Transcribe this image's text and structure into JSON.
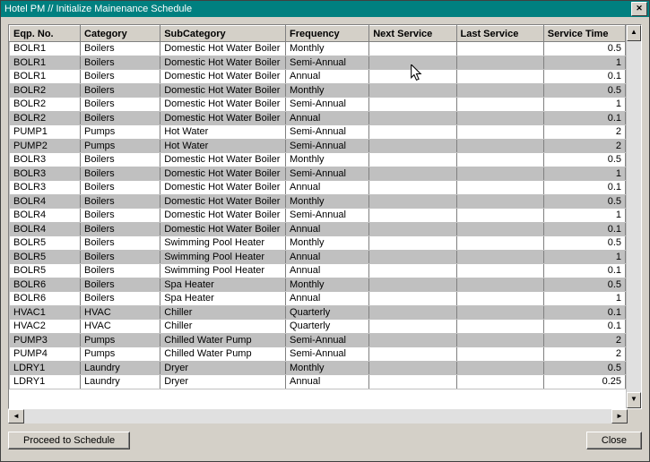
{
  "window": {
    "title": "Hotel PM // Initialize Mainenance Schedule"
  },
  "columns": [
    {
      "key": "eqp",
      "label": "Eqp. No.",
      "cls": "col-eqp"
    },
    {
      "key": "cat",
      "label": "Category",
      "cls": "col-cat"
    },
    {
      "key": "sub",
      "label": "SubCategory",
      "cls": "col-sub"
    },
    {
      "key": "freq",
      "label": "Frequency",
      "cls": "col-freq"
    },
    {
      "key": "next",
      "label": "Next Service",
      "cls": "col-next"
    },
    {
      "key": "last",
      "label": "Last Service",
      "cls": "col-last"
    },
    {
      "key": "time",
      "label": "Service Time",
      "cls": "col-time",
      "numeric": true
    }
  ],
  "rows": [
    {
      "eqp": "BOLR1",
      "cat": "Boilers",
      "sub": "Domestic Hot Water Boiler",
      "freq": "Monthly",
      "next": "",
      "last": "",
      "time": "0.5"
    },
    {
      "eqp": "BOLR1",
      "cat": "Boilers",
      "sub": "Domestic Hot Water Boiler",
      "freq": "Semi-Annual",
      "next": "",
      "last": "",
      "time": "1"
    },
    {
      "eqp": "BOLR1",
      "cat": "Boilers",
      "sub": "Domestic Hot Water Boiler",
      "freq": "Annual",
      "next": "",
      "last": "",
      "time": "0.1"
    },
    {
      "eqp": "BOLR2",
      "cat": "Boilers",
      "sub": "Domestic Hot Water Boiler",
      "freq": "Monthly",
      "next": "",
      "last": "",
      "time": "0.5"
    },
    {
      "eqp": "BOLR2",
      "cat": "Boilers",
      "sub": "Domestic Hot Water Boiler",
      "freq": "Semi-Annual",
      "next": "",
      "last": "",
      "time": "1"
    },
    {
      "eqp": "BOLR2",
      "cat": "Boilers",
      "sub": "Domestic Hot Water Boiler",
      "freq": "Annual",
      "next": "",
      "last": "",
      "time": "0.1"
    },
    {
      "eqp": "PUMP1",
      "cat": "Pumps",
      "sub": "Hot Water",
      "freq": "Semi-Annual",
      "next": "",
      "last": "",
      "time": "2"
    },
    {
      "eqp": "PUMP2",
      "cat": "Pumps",
      "sub": "Hot Water",
      "freq": "Semi-Annual",
      "next": "",
      "last": "",
      "time": "2"
    },
    {
      "eqp": "BOLR3",
      "cat": "Boilers",
      "sub": "Domestic Hot Water Boiler",
      "freq": "Monthly",
      "next": "",
      "last": "",
      "time": "0.5"
    },
    {
      "eqp": "BOLR3",
      "cat": "Boilers",
      "sub": "Domestic Hot Water Boiler",
      "freq": "Semi-Annual",
      "next": "",
      "last": "",
      "time": "1"
    },
    {
      "eqp": "BOLR3",
      "cat": "Boilers",
      "sub": "Domestic Hot Water Boiler",
      "freq": "Annual",
      "next": "",
      "last": "",
      "time": "0.1"
    },
    {
      "eqp": "BOLR4",
      "cat": "Boilers",
      "sub": "Domestic Hot Water Boiler",
      "freq": "Monthly",
      "next": "",
      "last": "",
      "time": "0.5"
    },
    {
      "eqp": "BOLR4",
      "cat": "Boilers",
      "sub": "Domestic Hot Water Boiler",
      "freq": "Semi-Annual",
      "next": "",
      "last": "",
      "time": "1"
    },
    {
      "eqp": "BOLR4",
      "cat": "Boilers",
      "sub": "Domestic Hot Water Boiler",
      "freq": "Annual",
      "next": "",
      "last": "",
      "time": "0.1"
    },
    {
      "eqp": "BOLR5",
      "cat": "Boilers",
      "sub": "Swimming Pool Heater",
      "freq": "Monthly",
      "next": "",
      "last": "",
      "time": "0.5"
    },
    {
      "eqp": "BOLR5",
      "cat": "Boilers",
      "sub": "Swimming Pool Heater",
      "freq": "Annual",
      "next": "",
      "last": "",
      "time": "1"
    },
    {
      "eqp": "BOLR5",
      "cat": "Boilers",
      "sub": "Swimming Pool Heater",
      "freq": "Annual",
      "next": "",
      "last": "",
      "time": "0.1"
    },
    {
      "eqp": "BOLR6",
      "cat": "Boilers",
      "sub": "Spa Heater",
      "freq": "Monthly",
      "next": "",
      "last": "",
      "time": "0.5"
    },
    {
      "eqp": "BOLR6",
      "cat": "Boilers",
      "sub": "Spa Heater",
      "freq": "Annual",
      "next": "",
      "last": "",
      "time": "1"
    },
    {
      "eqp": "HVAC1",
      "cat": "HVAC",
      "sub": "Chiller",
      "freq": "Quarterly",
      "next": "",
      "last": "",
      "time": "0.1"
    },
    {
      "eqp": "HVAC2",
      "cat": "HVAC",
      "sub": "Chiller",
      "freq": "Quarterly",
      "next": "",
      "last": "",
      "time": "0.1"
    },
    {
      "eqp": "PUMP3",
      "cat": "Pumps",
      "sub": "Chilled Water Pump",
      "freq": "Semi-Annual",
      "next": "",
      "last": "",
      "time": "2"
    },
    {
      "eqp": "PUMP4",
      "cat": "Pumps",
      "sub": "Chilled Water Pump",
      "freq": "Semi-Annual",
      "next": "",
      "last": "",
      "time": "2"
    },
    {
      "eqp": "LDRY1",
      "cat": "Laundry",
      "sub": "Dryer",
      "freq": "Monthly",
      "next": "",
      "last": "",
      "time": "0.5"
    },
    {
      "eqp": "LDRY1",
      "cat": "Laundry",
      "sub": "Dryer",
      "freq": "Annual",
      "next": "",
      "last": "",
      "time": "0.25"
    }
  ],
  "buttons": {
    "proceed": "Proceed to Schedule",
    "close": "Close"
  }
}
